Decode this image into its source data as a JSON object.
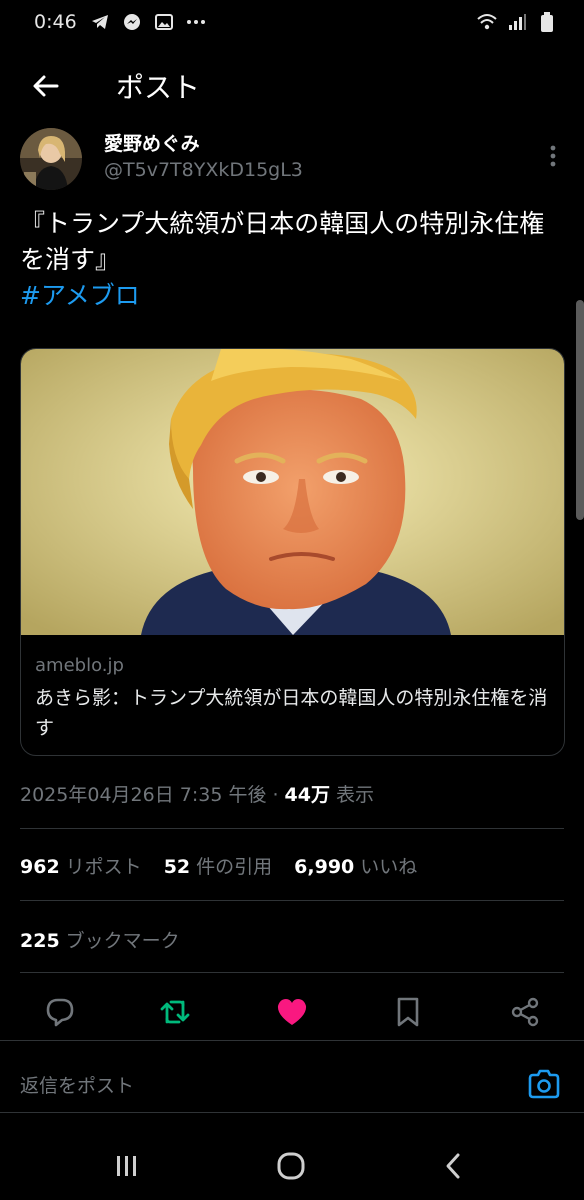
{
  "status_bar": {
    "time": "0:46",
    "left_icons": [
      "telegram-icon",
      "messenger-icon",
      "gallery-icon",
      "more-dots-icon"
    ],
    "right_icons": [
      "wifi-icon",
      "signal-icon",
      "battery-icon"
    ]
  },
  "header": {
    "title": "ポスト",
    "back_icon": "arrow-left-icon"
  },
  "author": {
    "display_name": "愛野めぐみ",
    "handle": "@T5v7T8YXkD15gL3"
  },
  "post": {
    "text": "『トランプ大統領が日本の韓国人の特別永住権を消す』",
    "hashtag": "#アメブロ"
  },
  "link_card": {
    "domain": "ameblo.jp",
    "title": "あきら影：トランプ大統領が日本の韓国人の特別永住権を消す"
  },
  "meta": {
    "timestamp": "2025年04月26日 7:35 午後 ·",
    "views_count": "44万",
    "views_label": "表示"
  },
  "stats": {
    "reposts_count": "962",
    "reposts_label": "リポスト",
    "quotes_count": "52",
    "quotes_label": "件の引用",
    "likes_count": "6,990",
    "likes_label": "いいね",
    "bookmarks_count": "225",
    "bookmarks_label": "ブックマーク"
  },
  "actions": {
    "icons": [
      "reply-icon",
      "repost-icon",
      "like-icon",
      "bookmark-icon",
      "share-icon"
    ],
    "repost_color": "#00ba7c",
    "like_color": "#f91880"
  },
  "reply": {
    "placeholder": "返信をポスト"
  },
  "colors": {
    "background": "#000000",
    "accent": "#1d9bf0",
    "muted": "#71767b",
    "divider": "#2f3336"
  }
}
